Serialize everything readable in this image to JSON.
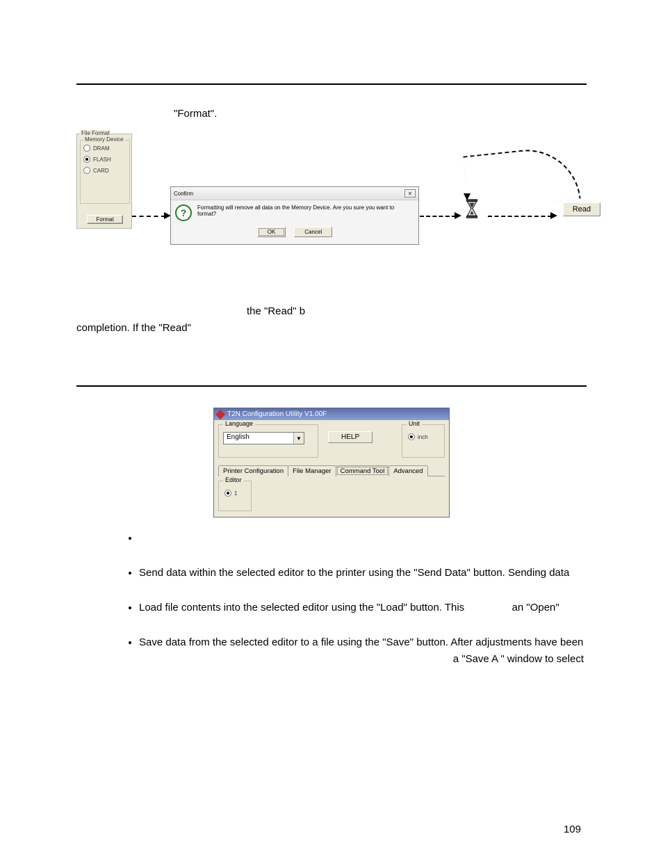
{
  "intro_text": "\"Format\".",
  "file_format": {
    "group_label": "File Format",
    "memory_group_label": "Memory Device",
    "radios": {
      "dram": "DRAM",
      "flash": "FLASH",
      "card": "CARD"
    },
    "format_btn": "Format"
  },
  "confirm_dialog": {
    "title": "Confirm",
    "message": "Formatting will remove all data on the Memory Device. Are you sure you want to format?",
    "ok": "OK",
    "cancel": "Cancel"
  },
  "read_btn": "Read",
  "para2_a": "the \"Read\" b",
  "para2_b": "completion. If the \"Read\"",
  "cmdtool": {
    "window_title": "T2N Configuration Utility V1.00F",
    "language_label": "Language",
    "language_value": "English",
    "help_btn": "HELP",
    "unit_label": "Unit",
    "unit_value": "inch",
    "tabs": {
      "printer_config": "Printer Configuration",
      "file_manager": "File Manager",
      "command_tool": "Command Tool",
      "advanced": "Advanced"
    },
    "editor_label": "Editor",
    "editor_value": "1"
  },
  "bullets": {
    "b1": "",
    "b2": "Send data within the selected editor to the printer using the \"Send Data\" button. Sending data",
    "b3a": "Load file contents into the selected editor using the \"Load\" button. This",
    "b3b": "an \"Open\"",
    "b4a": "Save data from the selected editor to a file using the \"Save\" button. After adjustments have been",
    "b4b": "a \"Save A  \" window to select"
  },
  "page_number": "109"
}
